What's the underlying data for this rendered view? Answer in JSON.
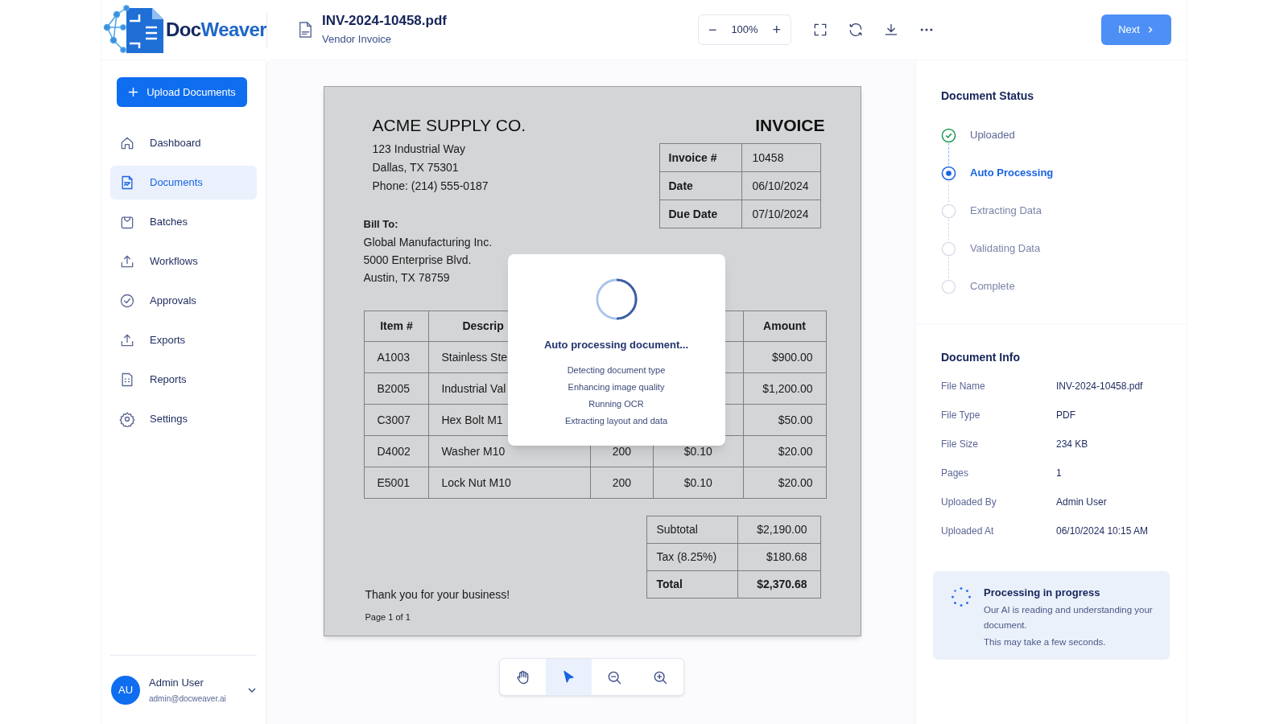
{
  "logo": {
    "text_dark": "Doc",
    "text_accent": "Weaver"
  },
  "document": {
    "file_name": "INV-2024-10458.pdf",
    "subtitle": "Vendor Invoice"
  },
  "zoom": {
    "minus": "−",
    "value": "100%",
    "plus": "+"
  },
  "toolbar_actions": [
    {
      "kind": "fullscreen"
    },
    {
      "kind": "refresh"
    },
    {
      "kind": "download"
    },
    {
      "kind": "more"
    }
  ],
  "next_button": {
    "label": "Next"
  },
  "sidebar": {
    "upload_button": "Upload Documents",
    "items": [
      {
        "label": "Dashboard",
        "kind": "home",
        "selected": false
      },
      {
        "label": "Documents",
        "kind": "document",
        "selected": true
      },
      {
        "label": "Batches",
        "kind": "clipboard",
        "selected": false
      },
      {
        "label": "Workflows",
        "kind": "upload",
        "selected": false
      },
      {
        "label": "Approvals",
        "kind": "approve",
        "selected": false
      },
      {
        "label": "Exports",
        "kind": "upload",
        "selected": false
      },
      {
        "label": "Reports",
        "kind": "report",
        "selected": false
      },
      {
        "label": "Settings",
        "kind": "gear",
        "selected": false
      }
    ],
    "user": {
      "initials": "AU",
      "name": "Admin User",
      "email": "admin@docweaver.ai"
    }
  },
  "invoice": {
    "company": "ACME SUPPLY CO.",
    "address_lines": [
      "123 Industrial Way",
      "Dallas, TX 75301",
      "Phone: (214) 555-0187"
    ],
    "title": "INVOICE",
    "meta": [
      {
        "label": "Invoice #",
        "value": "10458"
      },
      {
        "label": "Date",
        "value": "06/10/2024"
      },
      {
        "label": "Due Date",
        "value": "07/10/2024"
      }
    ],
    "bill_to_label": "Bill To:",
    "bill_to_lines": [
      "Global Manufacturing Inc.",
      "5000 Enterprise Blvd.",
      "Austin, TX 78759"
    ],
    "columns": [
      {
        "label": "Item #"
      },
      {
        "label": "Descrip"
      },
      {},
      {},
      {
        "label": "Amount"
      }
    ],
    "rows": [
      {
        "item": "A1003",
        "description": "Stainless Ste",
        "amount": "$900.00"
      },
      {
        "item": "B2005",
        "description": "Industrial Val",
        "amount": "$1,200.00"
      },
      {
        "item": "C3007",
        "description": "Hex Bolt M1",
        "amount": "$50.00"
      },
      {
        "item": "D4002",
        "description": "Washer M10",
        "quantity": "200",
        "price": "$0.10",
        "amount": "$20.00"
      },
      {
        "item": "E5001",
        "description": "Lock Nut M10",
        "quantity": "200",
        "price": "$0.10",
        "amount": "$20.00"
      }
    ],
    "totals": [
      {
        "label": "Subtotal",
        "value": "$2,190.00",
        "emphasis": false
      },
      {
        "label": "Tax (8.25%)",
        "value": "$180.68",
        "emphasis": false
      },
      {
        "label": "Total",
        "value": "$2,370.68",
        "emphasis": true
      }
    ],
    "footer_note": "Thank you for your business!",
    "page_label": "Page 1 of 1"
  },
  "processing_modal": {
    "title": "Auto processing document...",
    "steps": [
      "Detecting document type",
      "Enhancing image quality",
      "Running OCR",
      "Extracting layout and data"
    ]
  },
  "viewer_tools": [
    {
      "kind": "hand",
      "selected": false
    },
    {
      "kind": "pointer",
      "selected": true
    },
    {
      "kind": "zoom-out",
      "selected": false
    },
    {
      "kind": "zoom-in",
      "selected": false
    }
  ],
  "status_panel": {
    "title": "Document Status",
    "steps": [
      {
        "label": "Uploaded",
        "kind": "done"
      },
      {
        "label": "Auto Processing",
        "kind": "active"
      },
      {
        "label": "Extracting Data",
        "kind": "pending"
      },
      {
        "label": "Validating Data",
        "kind": "pending"
      },
      {
        "label": "Complete",
        "kind": "pending"
      }
    ]
  },
  "info_panel": {
    "title": "Document Info",
    "rows": [
      {
        "label": "File Name",
        "value": "INV-2024-10458.pdf"
      },
      {
        "label": "File Type",
        "value": "PDF"
      },
      {
        "label": "File Size",
        "value": "234 KB"
      },
      {
        "label": "Pages",
        "value": "1"
      },
      {
        "label": "Uploaded By",
        "value": "Admin User"
      },
      {
        "label": "Uploaded At",
        "value": "06/10/2024 10:15 AM"
      }
    ]
  },
  "progress_card": {
    "title": "Processing in progress",
    "lines": [
      "Our AI is reading and understanding your document.",
      "This may take a few seconds."
    ]
  }
}
